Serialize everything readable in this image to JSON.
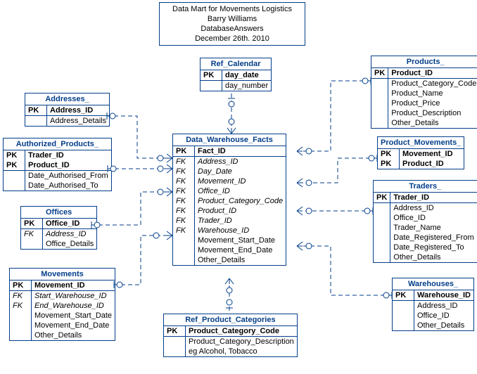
{
  "title": {
    "l1": "Data Mart for Movements Logistics",
    "l2": "Barry Williams",
    "l3": "DatabaseAnswers",
    "l4": "December 26th. 2010"
  },
  "entities": {
    "addresses": {
      "name": "Addresses_",
      "rows": [
        {
          "k": "PK",
          "n": "Address_ID",
          "sep": false
        },
        {
          "k": "",
          "n": "Address_Details",
          "sep": true
        }
      ]
    },
    "authorized": {
      "name": "Authorized_Products_",
      "rows": [
        {
          "k": "PK",
          "n": "Trader_ID",
          "sep": false
        },
        {
          "k": "PK",
          "n": "Product_ID",
          "sep": false
        },
        {
          "k": "",
          "n": "Date_Authorised_From",
          "sep": true
        },
        {
          "k": "",
          "n": "Date_Authorised_To",
          "sep": false
        }
      ]
    },
    "offices": {
      "name": "Offices",
      "rows": [
        {
          "k": "PK",
          "n": "Office_ID",
          "sep": false
        },
        {
          "k": "FK",
          "n": "Address_ID",
          "sep": true
        },
        {
          "k": "",
          "n": "Office_Details",
          "sep": false
        }
      ]
    },
    "movements": {
      "name": "Movements",
      "rows": [
        {
          "k": "PK",
          "n": "Movement_ID",
          "sep": false
        },
        {
          "k": "FK",
          "n": "Start_Warehouse_ID",
          "sep": true
        },
        {
          "k": "FK",
          "n": "End_Warehouse_ID",
          "sep": false
        },
        {
          "k": "",
          "n": "Movement_Start_Date",
          "sep": false
        },
        {
          "k": "",
          "n": "Movement_End_Date",
          "sep": false
        },
        {
          "k": "",
          "n": "Other_Details",
          "sep": false
        }
      ]
    },
    "calendar": {
      "name": "Ref_Calendar",
      "rows": [
        {
          "k": "PK",
          "n": "day_date",
          "sep": false
        },
        {
          "k": "",
          "n": "day_number",
          "sep": true
        }
      ]
    },
    "facts": {
      "name": "Data_Warehouse_Facts",
      "rows": [
        {
          "k": "PK",
          "n": "Fact_ID",
          "sep": false
        },
        {
          "k": "FK",
          "n": "Address_ID",
          "sep": true
        },
        {
          "k": "FK",
          "n": "Day_Date",
          "sep": false
        },
        {
          "k": "FK",
          "n": "Movement_ID",
          "sep": false
        },
        {
          "k": "FK",
          "n": "Office_ID",
          "sep": false
        },
        {
          "k": "FK",
          "n": "Product_Category_Code",
          "sep": false
        },
        {
          "k": "FK",
          "n": "Product_ID",
          "sep": false
        },
        {
          "k": "FK",
          "n": "Trader_ID",
          "sep": false
        },
        {
          "k": "FK",
          "n": "Warehouse_ID",
          "sep": false
        },
        {
          "k": "",
          "n": "Movement_Start_Date",
          "sep": false
        },
        {
          "k": "",
          "n": "Movement_End_Date",
          "sep": false
        },
        {
          "k": "",
          "n": "Other_Details",
          "sep": false
        }
      ]
    },
    "categories": {
      "name": "Ref_Product_Categories",
      "rows": [
        {
          "k": "PK",
          "n": "Product_Category_Code",
          "sep": false
        },
        {
          "k": "",
          "n": "Product_Category_Description",
          "sep": true
        },
        {
          "k": "",
          "n": "eg Alcohol, Tobacco",
          "sep": false
        }
      ]
    },
    "products": {
      "name": "Products_",
      "rows": [
        {
          "k": "PK",
          "n": "Product_ID",
          "sep": false
        },
        {
          "k": "",
          "n": "Product_Category_Code",
          "sep": true
        },
        {
          "k": "",
          "n": "Product_Name",
          "sep": false
        },
        {
          "k": "",
          "n": "Product_Price",
          "sep": false
        },
        {
          "k": "",
          "n": "Product_Description",
          "sep": false
        },
        {
          "k": "",
          "n": "Other_Details",
          "sep": false
        }
      ]
    },
    "productmovements": {
      "name": "Product_Movements_",
      "rows": [
        {
          "k": "PK",
          "n": "Movement_ID",
          "sep": false
        },
        {
          "k": "PK",
          "n": "Product_ID",
          "sep": false
        }
      ]
    },
    "traders": {
      "name": "Traders_",
      "rows": [
        {
          "k": "PK",
          "n": "Trader_ID",
          "sep": false
        },
        {
          "k": "",
          "n": "Address_ID",
          "sep": true
        },
        {
          "k": "",
          "n": "Office_ID",
          "sep": false
        },
        {
          "k": "",
          "n": "Trader_Name",
          "sep": false
        },
        {
          "k": "",
          "n": "Date_Registered_From",
          "sep": false
        },
        {
          "k": "",
          "n": "Date_Registered_To",
          "sep": false
        },
        {
          "k": "",
          "n": "Other_Details",
          "sep": false
        }
      ]
    },
    "warehouses": {
      "name": "Warehouses_",
      "rows": [
        {
          "k": "PK",
          "n": "Warehouse_ID",
          "sep": false
        },
        {
          "k": "",
          "n": "Address_ID",
          "sep": true
        },
        {
          "k": "",
          "n": "Office_ID",
          "sep": false
        },
        {
          "k": "",
          "n": "Other_Details",
          "sep": false
        }
      ]
    }
  }
}
